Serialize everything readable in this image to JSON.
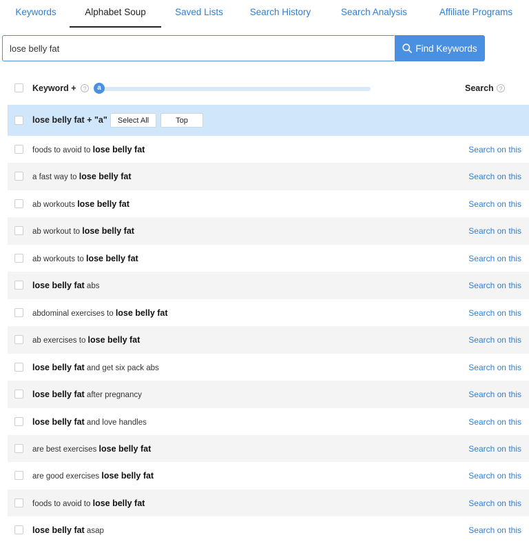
{
  "tabs": [
    {
      "label": "Keywords"
    },
    {
      "label": "Alphabet Soup"
    },
    {
      "label": "Saved Lists"
    },
    {
      "label": "Search History"
    },
    {
      "label": "Search Analysis"
    },
    {
      "label": "Affiliate Programs"
    }
  ],
  "active_tab": "Alphabet Soup",
  "search": {
    "value": "lose belly fat",
    "button_label": "Find Keywords"
  },
  "header": {
    "keyword_label": "Keyword +",
    "slider_letter": "a",
    "search_label": "Search"
  },
  "group": {
    "label": "lose belly fat + \"a\"",
    "select_all_label": "Select All",
    "top_label": "Top"
  },
  "search_link_label": "Search on this",
  "rows": [
    {
      "before": "foods to avoid to ",
      "bold": "lose belly fat",
      "after": ""
    },
    {
      "before": "a fast way to ",
      "bold": "lose belly fat",
      "after": ""
    },
    {
      "before": "ab workouts ",
      "bold": "lose belly fat",
      "after": ""
    },
    {
      "before": "ab workout to ",
      "bold": "lose belly fat",
      "after": ""
    },
    {
      "before": "ab workouts to ",
      "bold": "lose belly fat",
      "after": ""
    },
    {
      "before": "",
      "bold": "lose belly fat",
      "after": " abs"
    },
    {
      "before": "abdominal exercises to ",
      "bold": "lose belly fat",
      "after": ""
    },
    {
      "before": "ab exercises to ",
      "bold": "lose belly fat",
      "after": ""
    },
    {
      "before": "",
      "bold": "lose belly fat",
      "after": " and get six pack abs"
    },
    {
      "before": "",
      "bold": "lose belly fat",
      "after": " after pregnancy"
    },
    {
      "before": "",
      "bold": "lose belly fat",
      "after": " and love handles"
    },
    {
      "before": "are best exercises ",
      "bold": "lose belly fat",
      "after": ""
    },
    {
      "before": "are good exercises ",
      "bold": "lose belly fat",
      "after": ""
    },
    {
      "before": "foods to avoid to ",
      "bold": "lose belly fat",
      "after": ""
    },
    {
      "before": "",
      "bold": "lose belly fat",
      "after": " asap"
    }
  ],
  "colors": {
    "accent": "#4a90e2",
    "link": "#2d7fd6",
    "group_bg": "#cfe6fb",
    "row_alt_bg": "#f4f4f4"
  }
}
